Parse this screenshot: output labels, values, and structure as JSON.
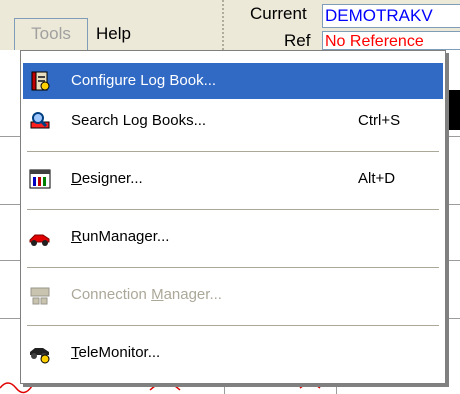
{
  "menubar": {
    "tools_label": "Tools",
    "help_label": "Help"
  },
  "toolbar": {
    "current_label": "Current",
    "current_value": "DEMOTRAKV",
    "ref_label": "Ref",
    "ref_value": "No Reference"
  },
  "menu": {
    "items": [
      {
        "label_pre": "",
        "label_accel": "",
        "label_post": "Configure Log Book...",
        "shortcut": "",
        "icon": "logbook-config-icon",
        "state": "highlighted"
      },
      {
        "label_pre": "",
        "label_accel": "",
        "label_post": "Search Log Books...",
        "shortcut": "Ctrl+S",
        "icon": "search-logbook-icon",
        "state": "normal"
      },
      {
        "label_pre": "",
        "label_accel": "D",
        "label_post": "esigner...",
        "shortcut": "Alt+D",
        "icon": "designer-icon",
        "state": "normal"
      },
      {
        "label_pre": "",
        "label_accel": "R",
        "label_post": "unManager...",
        "shortcut": "",
        "icon": "race-car-icon",
        "state": "normal"
      },
      {
        "label_pre": "Connection ",
        "label_accel": "M",
        "label_post": "anager...",
        "shortcut": "",
        "icon": "connection-icon",
        "state": "disabled"
      },
      {
        "label_pre": "",
        "label_accel": "T",
        "label_post": "eleMonitor...",
        "shortcut": "",
        "icon": "telemonitor-icon",
        "state": "normal"
      }
    ]
  },
  "colors": {
    "highlight": "#316ac5",
    "current_text": "#0000ff",
    "ref_text": "#ff0000",
    "disabled_text": "#aca899"
  }
}
